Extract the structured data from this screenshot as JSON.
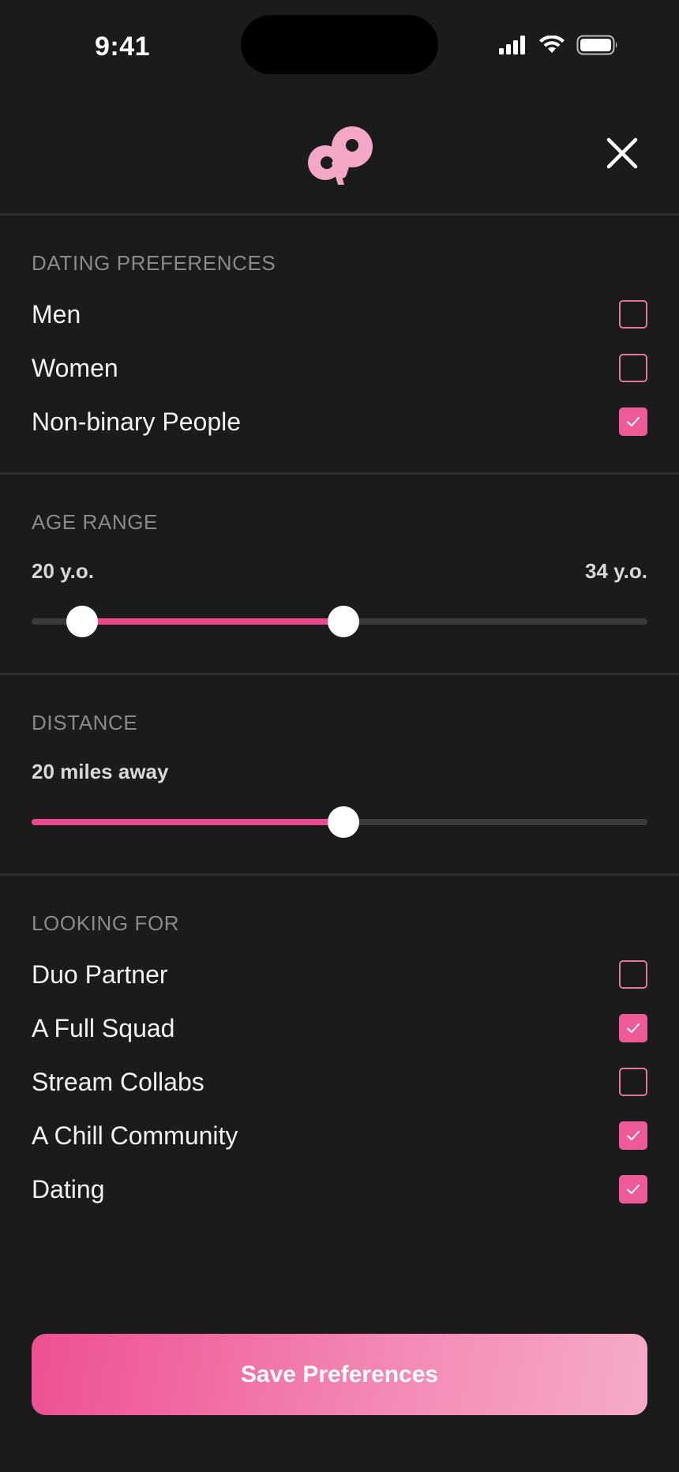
{
  "status_bar": {
    "time": "9:41"
  },
  "header": {
    "logo": "app-logo",
    "close_icon": "close-icon"
  },
  "dating_preferences": {
    "title": "DATING PREFERENCES",
    "options": [
      {
        "label": "Men",
        "checked": false
      },
      {
        "label": "Women",
        "checked": false
      },
      {
        "label": "Non-binary People",
        "checked": true
      }
    ]
  },
  "age_range": {
    "title": "AGE RANGE",
    "min_label": "20 y.o.",
    "max_label": "34 y.o.",
    "low_fraction": 0.082,
    "high_fraction": 0.506
  },
  "distance": {
    "title": "DISTANCE",
    "value_label": "20 miles away",
    "fraction": 0.506
  },
  "looking_for": {
    "title": "LOOKING FOR",
    "options": [
      {
        "label": "Duo Partner",
        "checked": false
      },
      {
        "label": "A Full Squad",
        "checked": true
      },
      {
        "label": "Stream Collabs",
        "checked": false
      },
      {
        "label": "A Chill Community",
        "checked": true
      },
      {
        "label": "Dating",
        "checked": true
      }
    ]
  },
  "save_button": {
    "label": "Save Preferences"
  },
  "colors": {
    "accent": "#ec5b97",
    "background": "#1b1b1b",
    "logo": "#f4a6c7"
  }
}
